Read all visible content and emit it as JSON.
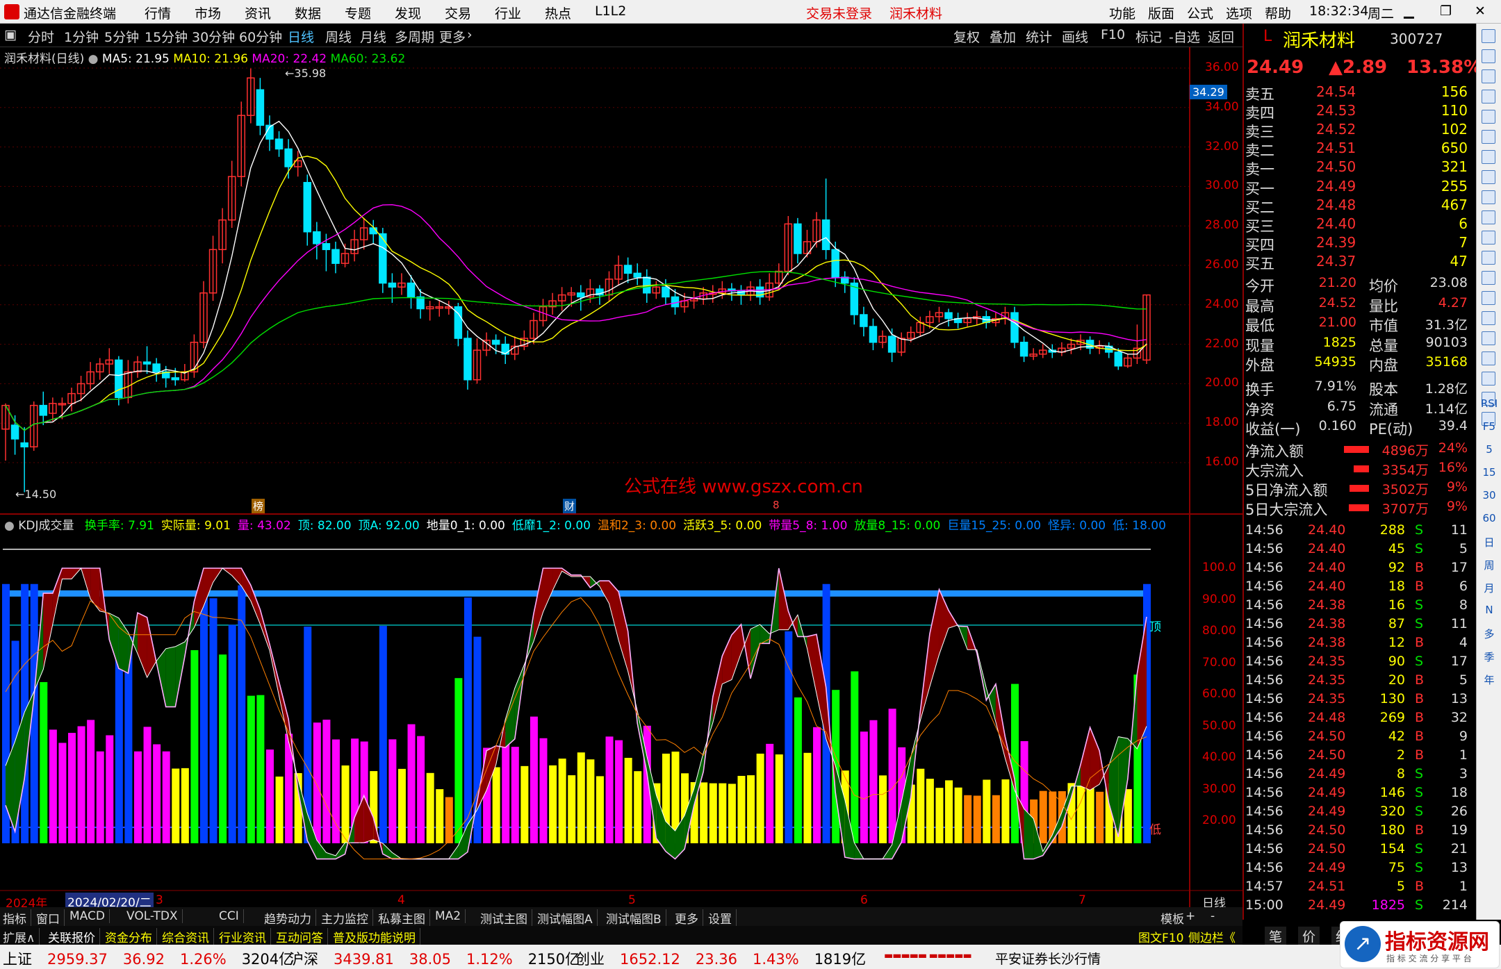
{
  "titlebar": {
    "app": "通达信金融终端",
    "menus": [
      "行情",
      "市场",
      "资讯",
      "数据",
      "专题",
      "发现",
      "交易",
      "行业",
      "热点",
      "L1L2"
    ],
    "login": "交易未登录",
    "stock": "润禾材料",
    "right_menus": [
      "功能",
      "版面",
      "公式",
      "选项",
      "帮助"
    ],
    "time": "18:32:34",
    "weekday": "周二"
  },
  "periodbar": {
    "periods": [
      "分时",
      "1分钟",
      "5分钟",
      "15分钟",
      "30分钟",
      "60分钟",
      "日线",
      "周线",
      "月线",
      "多周期",
      "更多"
    ],
    "active": "日线",
    "tools": [
      "复权",
      "叠加",
      "统计",
      "画线",
      "F10",
      "标记",
      "-自选",
      "返回"
    ]
  },
  "chart_main": {
    "title": "润禾材料(日线)",
    "ma5": "MA5: 21.95",
    "ma10": "MA10: 21.96",
    "ma20": "MA20: 22.42",
    "ma60": "MA60: 23.62",
    "high_label": "35.98",
    "low_label": "14.50",
    "cursor_price": "34.29",
    "y_ticks": [
      "36.00",
      "34.00",
      "32.00",
      "30.00",
      "28.00",
      "26.00",
      "24.00",
      "22.00",
      "20.00",
      "18.00",
      "16.00"
    ],
    "watermark": "公式在线  www.gszx.com.cn",
    "markers": [
      "榜",
      "财",
      "8"
    ]
  },
  "chart_indicator": {
    "name": "KDJ成交量",
    "fields": [
      {
        "k": "换手率",
        "v": "7.91",
        "c": "#00ff00"
      },
      {
        "k": "实际量",
        "v": "9.01",
        "c": "#ffff00"
      },
      {
        "k": "量",
        "v": "43.02",
        "c": "#ff00ff"
      },
      {
        "k": "顶",
        "v": "82.00",
        "c": "#00ffff"
      },
      {
        "k": "顶A",
        "v": "92.00",
        "c": "#00ffff"
      },
      {
        "k": "地量0_1",
        "v": "0.00",
        "c": "#ffffff"
      },
      {
        "k": "低靡1_2",
        "v": "0.00",
        "c": "#00ffff"
      },
      {
        "k": "温和2_3",
        "v": "0.00",
        "c": "#ff8000"
      },
      {
        "k": "活跃3_5",
        "v": "0.00",
        "c": "#ffff00"
      },
      {
        "k": "带量5_8",
        "v": "1.00",
        "c": "#ff00ff"
      },
      {
        "k": "放量8_15",
        "v": "0.00",
        "c": "#00ff00"
      },
      {
        "k": "巨量15_25",
        "v": "0.00",
        "c": "#0080ff"
      },
      {
        "k": "怪异",
        "v": "0.00",
        "c": "#0080ff"
      },
      {
        "k": "低",
        "v": "18.00",
        "c": "#0080ff"
      }
    ],
    "y_ticks": [
      "100.0",
      "90.00",
      "80.00",
      "70.00",
      "60.00",
      "50.00",
      "40.00",
      "30.00",
      "20.00"
    ],
    "label_top": "顶",
    "label_low": "低"
  },
  "xaxis": {
    "year": "2024年",
    "cursor_date": "2024/02/20/二",
    "months": [
      "3",
      "4",
      "5",
      "6",
      "7"
    ],
    "period": "日线"
  },
  "chart_data": {
    "type": "candlestick",
    "ylim": [
      14,
      37
    ],
    "candles": [
      [
        17.7,
        18.9,
        16.1,
        19.0
      ],
      [
        17.9,
        17.2,
        16.4,
        18.4
      ],
      [
        17.0,
        16.8,
        14.5,
        17.8
      ],
      [
        16.8,
        18.9,
        16.6,
        19.1
      ],
      [
        18.9,
        18.4,
        17.9,
        19.6
      ],
      [
        18.5,
        19.0,
        18.1,
        19.3
      ],
      [
        19.0,
        19.0,
        18.2,
        19.3
      ],
      [
        19.0,
        19.5,
        18.6,
        19.8
      ],
      [
        19.5,
        20.0,
        19.1,
        20.4
      ],
      [
        20.0,
        20.6,
        19.7,
        21.1
      ],
      [
        20.6,
        21.0,
        20.2,
        21.3
      ],
      [
        21.0,
        21.2,
        20.5,
        21.8
      ],
      [
        21.2,
        19.3,
        18.9,
        21.4
      ],
      [
        19.3,
        20.6,
        19.0,
        21.2
      ],
      [
        20.6,
        21.1,
        20.3,
        21.4
      ],
      [
        21.1,
        21.0,
        20.5,
        21.9
      ],
      [
        21.0,
        20.6,
        20.1,
        21.3
      ],
      [
        20.6,
        20.3,
        19.8,
        20.9
      ],
      [
        20.3,
        20.2,
        19.9,
        20.8
      ],
      [
        20.2,
        20.6,
        20.1,
        21.0
      ],
      [
        20.6,
        22.1,
        20.3,
        22.5
      ],
      [
        22.1,
        24.6,
        21.8,
        25.2
      ],
      [
        24.6,
        26.8,
        24.2,
        27.5
      ],
      [
        26.8,
        28.3,
        26.1,
        28.9
      ],
      [
        28.3,
        30.5,
        27.9,
        31.3
      ],
      [
        30.5,
        33.6,
        30.0,
        34.3
      ],
      [
        33.6,
        35.5,
        33.2,
        35.98
      ],
      [
        34.9,
        33.1,
        32.6,
        35.5
      ],
      [
        33.1,
        32.4,
        31.8,
        33.6
      ],
      [
        32.4,
        31.9,
        31.5,
        32.8
      ],
      [
        31.9,
        31.0,
        30.4,
        32.4
      ],
      [
        31.0,
        31.3,
        30.5,
        31.8
      ],
      [
        30.2,
        27.7,
        27.0,
        30.6
      ],
      [
        27.7,
        27.1,
        26.3,
        28.2
      ],
      [
        27.1,
        26.8,
        25.7,
        27.6
      ],
      [
        26.8,
        26.1,
        25.6,
        27.2
      ],
      [
        26.1,
        26.6,
        25.9,
        27.1
      ],
      [
        26.6,
        27.3,
        26.2,
        27.8
      ],
      [
        27.3,
        27.9,
        26.8,
        28.4
      ],
      [
        27.9,
        27.6,
        27.1,
        28.3
      ],
      [
        27.6,
        25.1,
        24.6,
        27.9
      ],
      [
        25.1,
        24.9,
        24.1,
        25.6
      ],
      [
        24.9,
        25.1,
        24.5,
        25.6
      ],
      [
        25.1,
        24.4,
        23.8,
        25.5
      ],
      [
        24.4,
        23.8,
        23.3,
        24.8
      ],
      [
        23.8,
        23.9,
        23.2,
        24.2
      ],
      [
        23.9,
        23.9,
        23.4,
        24.2
      ],
      [
        23.9,
        23.9,
        23.5,
        24.2
      ],
      [
        23.9,
        22.3,
        21.9,
        24.1
      ],
      [
        22.3,
        20.2,
        19.7,
        22.7
      ],
      [
        20.2,
        21.7,
        20.0,
        22.3
      ],
      [
        21.7,
        22.2,
        21.4,
        22.6
      ],
      [
        22.2,
        22.0,
        21.5,
        22.5
      ],
      [
        22.0,
        21.5,
        21.0,
        22.4
      ],
      [
        21.5,
        21.9,
        21.2,
        22.4
      ],
      [
        21.9,
        22.3,
        21.7,
        22.7
      ],
      [
        22.3,
        23.2,
        22.0,
        23.6
      ],
      [
        23.2,
        23.9,
        22.9,
        24.3
      ],
      [
        23.9,
        24.2,
        23.5,
        24.6
      ],
      [
        24.2,
        24.5,
        23.7,
        24.9
      ],
      [
        24.5,
        24.6,
        23.9,
        24.9
      ],
      [
        24.6,
        24.4,
        23.7,
        25.0
      ],
      [
        24.4,
        24.8,
        24.1,
        25.3
      ],
      [
        24.8,
        24.5,
        24.0,
        25.0
      ],
      [
        24.5,
        25.3,
        24.2,
        25.7
      ],
      [
        25.3,
        26.0,
        25.0,
        26.5
      ],
      [
        26.0,
        25.6,
        25.1,
        26.4
      ],
      [
        25.6,
        25.4,
        25.0,
        26.1
      ],
      [
        25.4,
        24.6,
        24.1,
        25.8
      ],
      [
        24.6,
        24.9,
        24.3,
        25.2
      ],
      [
        24.9,
        24.4,
        24.0,
        25.3
      ],
      [
        24.4,
        23.9,
        23.5,
        24.8
      ],
      [
        23.9,
        24.2,
        23.6,
        24.6
      ],
      [
        24.2,
        24.3,
        23.8,
        24.7
      ],
      [
        24.3,
        24.6,
        24.0,
        24.9
      ],
      [
        24.6,
        24.6,
        24.1,
        25.0
      ],
      [
        24.6,
        24.8,
        24.3,
        25.2
      ],
      [
        24.8,
        24.7,
        24.2,
        25.1
      ],
      [
        24.7,
        24.5,
        24.0,
        25.0
      ],
      [
        24.5,
        24.9,
        24.2,
        25.2
      ],
      [
        24.9,
        24.4,
        24.0,
        25.3
      ],
      [
        24.4,
        25.1,
        24.2,
        25.6
      ],
      [
        25.1,
        25.7,
        24.8,
        26.1
      ],
      [
        25.7,
        28.1,
        25.5,
        28.5
      ],
      [
        28.1,
        26.6,
        26.1,
        28.4
      ],
      [
        26.6,
        27.2,
        26.4,
        27.8
      ],
      [
        27.2,
        28.3,
        26.9,
        28.7
      ],
      [
        28.3,
        26.8,
        26.3,
        30.4
      ],
      [
        26.8,
        25.4,
        24.9,
        27.2
      ],
      [
        25.4,
        25.1,
        24.6,
        25.7
      ],
      [
        25.1,
        23.5,
        23.0,
        25.4
      ],
      [
        23.5,
        22.9,
        22.4,
        23.9
      ],
      [
        22.9,
        22.1,
        21.7,
        23.3
      ],
      [
        22.1,
        22.4,
        21.8,
        22.7
      ],
      [
        22.4,
        21.6,
        21.1,
        22.8
      ],
      [
        21.6,
        22.3,
        21.4,
        22.6
      ],
      [
        22.3,
        22.6,
        22.1,
        22.9
      ],
      [
        22.6,
        23.1,
        22.4,
        23.4
      ],
      [
        23.1,
        23.4,
        22.8,
        23.7
      ],
      [
        23.4,
        23.6,
        23.1,
        23.9
      ],
      [
        23.6,
        23.3,
        22.9,
        23.8
      ],
      [
        23.3,
        23.1,
        22.8,
        23.6
      ],
      [
        23.1,
        23.3,
        22.9,
        23.6
      ],
      [
        23.3,
        23.4,
        23.0,
        23.7
      ],
      [
        23.4,
        23.1,
        22.8,
        23.7
      ],
      [
        23.1,
        23.3,
        22.9,
        23.6
      ],
      [
        23.3,
        23.6,
        23.0,
        23.9
      ],
      [
        23.6,
        22.1,
        21.8,
        23.9
      ],
      [
        22.1,
        21.4,
        21.1,
        22.4
      ],
      [
        21.4,
        21.5,
        21.2,
        21.8
      ],
      [
        21.5,
        21.7,
        21.3,
        22.0
      ],
      [
        21.7,
        21.6,
        21.3,
        22.0
      ],
      [
        21.6,
        21.8,
        21.4,
        22.1
      ],
      [
        21.8,
        22.0,
        21.5,
        22.3
      ],
      [
        22.0,
        22.2,
        21.7,
        22.5
      ],
      [
        22.2,
        21.8,
        21.5,
        22.4
      ],
      [
        21.8,
        21.9,
        21.5,
        22.2
      ],
      [
        21.9,
        21.6,
        21.3,
        22.1
      ],
      [
        21.6,
        20.9,
        20.7,
        21.8
      ],
      [
        20.9,
        21.3,
        20.8,
        21.5
      ],
      [
        21.3,
        21.8,
        21.0,
        23.0
      ],
      [
        21.2,
        24.5,
        21.0,
        24.5
      ]
    ]
  },
  "rightpanel": {
    "code_prefix": "L",
    "name": "润禾材料",
    "code": "300727",
    "price": "24.49",
    "change": "▲2.89",
    "pct": "13.38%",
    "asks": [
      {
        "l": "卖五",
        "p": "24.54",
        "v": "156"
      },
      {
        "l": "卖四",
        "p": "24.53",
        "v": "110"
      },
      {
        "l": "卖三",
        "p": "24.52",
        "v": "102"
      },
      {
        "l": "卖二",
        "p": "24.51",
        "v": "650"
      },
      {
        "l": "卖一",
        "p": "24.50",
        "v": "321"
      }
    ],
    "bids": [
      {
        "l": "买一",
        "p": "24.49",
        "v": "255"
      },
      {
        "l": "买二",
        "p": "24.48",
        "v": "467"
      },
      {
        "l": "买三",
        "p": "24.40",
        "v": "6"
      },
      {
        "l": "买四",
        "p": "24.39",
        "v": "7"
      },
      {
        "l": "买五",
        "p": "24.37",
        "v": "47"
      }
    ],
    "stats": [
      [
        "今开",
        "21.20",
        "均价",
        "23.08"
      ],
      [
        "最高",
        "24.52",
        "量比",
        "4.27"
      ],
      [
        "最低",
        "21.00",
        "市值",
        "31.3亿"
      ],
      [
        "现量",
        "1825",
        "总量",
        "90103"
      ],
      [
        "外盘",
        "54935",
        "内盘",
        "35168"
      ],
      [
        "换手",
        "7.91%",
        "股本",
        "1.28亿"
      ],
      [
        "净资",
        "6.75",
        "流通",
        "1.14亿"
      ],
      [
        "收益(一)",
        "0.160",
        "PE(动)",
        "39.4"
      ]
    ],
    "flows": [
      {
        "l": "净流入额",
        "v": "4896万",
        "p": "24%",
        "w": 0.9
      },
      {
        "l": "大宗流入",
        "v": "3354万",
        "p": "16%",
        "w": 0.55
      },
      {
        "l": "5日净流入额",
        "v": "3502万",
        "p": "9%",
        "w": 0.7
      },
      {
        "l": "5日大宗流入",
        "v": "3707万",
        "p": "9%",
        "w": 0.72
      }
    ],
    "ticks": [
      [
        "14:56",
        "24.40",
        "288",
        "S",
        "11"
      ],
      [
        "14:56",
        "24.40",
        "45",
        "S",
        "5"
      ],
      [
        "14:56",
        "24.40",
        "92",
        "B",
        "17"
      ],
      [
        "14:56",
        "24.40",
        "18",
        "B",
        "6"
      ],
      [
        "14:56",
        "24.38",
        "16",
        "S",
        "8"
      ],
      [
        "14:56",
        "24.38",
        "87",
        "S",
        "11"
      ],
      [
        "14:56",
        "24.38",
        "12",
        "B",
        "4"
      ],
      [
        "14:56",
        "24.35",
        "90",
        "S",
        "17"
      ],
      [
        "14:56",
        "24.35",
        "20",
        "B",
        "5"
      ],
      [
        "14:56",
        "24.35",
        "130",
        "B",
        "13"
      ],
      [
        "14:56",
        "24.48",
        "269",
        "B",
        "32"
      ],
      [
        "14:56",
        "24.50",
        "42",
        "B",
        "9"
      ],
      [
        "14:56",
        "24.50",
        "2",
        "B",
        "1"
      ],
      [
        "14:56",
        "24.49",
        "8",
        "S",
        "3"
      ],
      [
        "14:56",
        "24.49",
        "146",
        "S",
        "18"
      ],
      [
        "14:56",
        "24.49",
        "320",
        "S",
        "26"
      ],
      [
        "14:56",
        "24.50",
        "180",
        "B",
        "19"
      ],
      [
        "14:56",
        "24.50",
        "154",
        "S",
        "21"
      ],
      [
        "14:56",
        "24.49",
        "75",
        "S",
        "13"
      ],
      [
        "14:57",
        "24.51",
        "5",
        "B",
        "1"
      ],
      [
        "15:00",
        "24.49",
        "1825",
        "S",
        "214"
      ]
    ],
    "bottom_tabs": [
      "笔",
      "价",
      "细",
      "盘"
    ]
  },
  "iconstrip": {
    "labels": [
      "RSI",
      "F5",
      "5",
      "15",
      "30",
      "60",
      "日",
      "周",
      "月",
      "N",
      "多",
      "季",
      "年"
    ]
  },
  "bottomtabs": {
    "row1": [
      "指标",
      "窗口",
      "MACD",
      "VOL-TDX",
      "CCI",
      "趋势动力",
      "主力监控",
      "私募主图",
      "MA2",
      "测试主图",
      "测试幅图A",
      "测试幅图B",
      "更多",
      "设置"
    ],
    "right": [
      "模板",
      "+",
      "-"
    ],
    "row2": [
      "扩展∧",
      "关联报价",
      "资金分布",
      "综合资讯",
      "行业资讯",
      "互动问答",
      "普及版功能说明"
    ],
    "row2_right": [
      "图文F10",
      "侧边栏《"
    ]
  },
  "statusbar": {
    "items": [
      {
        "n": "上证",
        "p": "2959.37",
        "c": "36.92",
        "pc": "1.26%",
        "v": "3204亿"
      },
      {
        "n": "沪深",
        "p": "3439.81",
        "c": "38.05",
        "pc": "1.12%",
        "v": "2150亿"
      },
      {
        "n": "创业",
        "p": "1652.12",
        "c": "23.36",
        "pc": "1.43%",
        "v": "1819亿"
      }
    ],
    "broker": "平安证券长沙行情",
    "logo_main": "指标资源网",
    "logo_sub": "指 标 交 流 分 享 平 台"
  }
}
